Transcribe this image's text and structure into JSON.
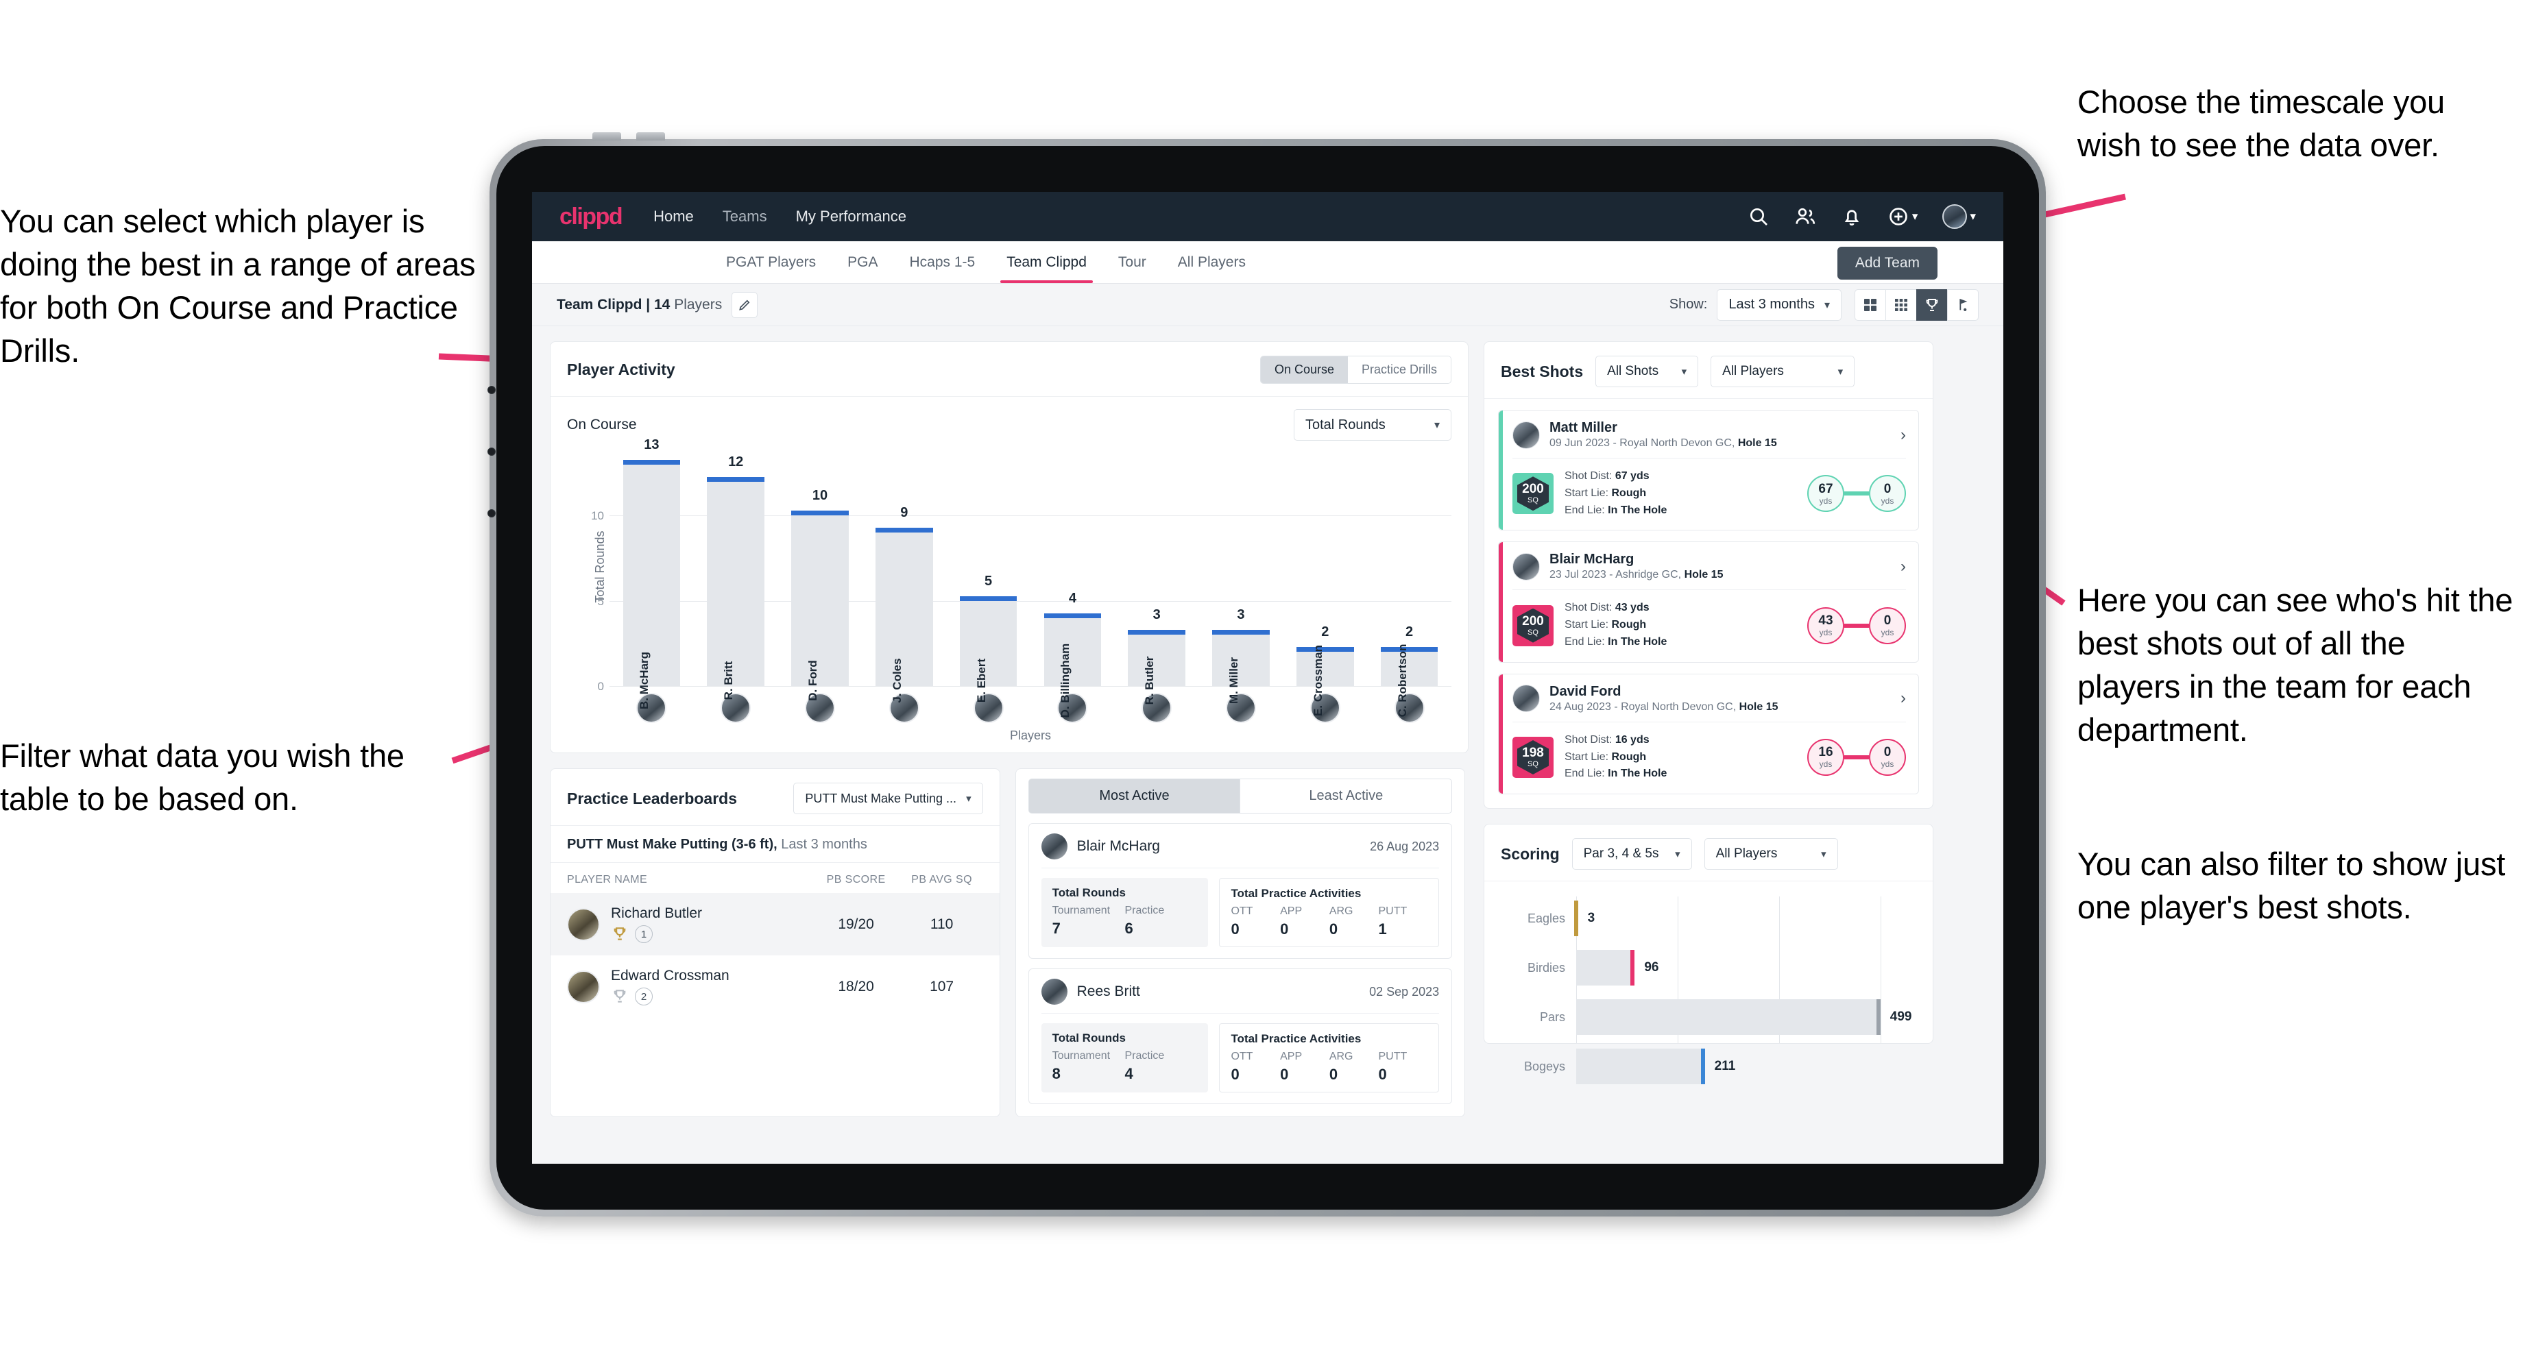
{
  "annotations": {
    "top_right": "Choose the timescale you wish to see the data over.",
    "left_top": "You can select which player is doing the best in a range of areas for both On Course and Practice Drills.",
    "left_bottom": "Filter what data you wish the table to be based on.",
    "right_middle": "Here you can see who's hit the best shots out of all the players in the team for each department.",
    "right_bottom": "You can also filter to show just one player's best shots."
  },
  "topnav": {
    "logo": "clippd",
    "links": [
      "Home",
      "Teams",
      "My Performance"
    ],
    "icons": [
      "search-icon",
      "people-icon",
      "bell-icon",
      "plus-circle-icon",
      "avatar"
    ]
  },
  "tabs": {
    "items": [
      "PGAT Players",
      "PGA",
      "Hcaps 1-5",
      "Team Clippd",
      "Tour",
      "All Players"
    ],
    "active": "Team Clippd",
    "add_team_label": "Add Team"
  },
  "teamstrip": {
    "team_label": "Team Clippd | ",
    "player_count": "14",
    "players_word": " Players",
    "show_label": "Show:",
    "timescale_value": "Last 3 months",
    "view_icons": [
      "grid-4-icon",
      "grid-9-icon",
      "trophy-icon",
      "golf-flag-icon"
    ],
    "active_view": "trophy-icon"
  },
  "player_activity": {
    "title": "Player Activity",
    "segments": [
      "On Course",
      "Practice Drills"
    ],
    "active_segment": "On Course",
    "subtitle": "On Course",
    "metric_select": "Total Rounds"
  },
  "best_shots": {
    "title": "Best Shots",
    "filter_shots": "All Shots",
    "filter_players": "All Players",
    "cards": [
      {
        "accent": "teal",
        "name": "Matt Miller",
        "meta_date": "09 Jun 2023 - Royal North Devon GC, ",
        "meta_hole": "Hole 15",
        "sq_value": "200",
        "sq_unit": "SQ",
        "shot_dist_label": "Shot Dist: ",
        "shot_dist": "67 yds",
        "start_lie_label": "Start Lie: ",
        "start_lie": "Rough",
        "end_lie_label": "End Lie: ",
        "end_lie": "In The Hole",
        "from_value": "67",
        "from_unit": "yds",
        "to_value": "0",
        "to_unit": "yds"
      },
      {
        "accent": "pink",
        "name": "Blair McHarg",
        "meta_date": "23 Jul 2023 - Ashridge GC, ",
        "meta_hole": "Hole 15",
        "sq_value": "200",
        "sq_unit": "SQ",
        "shot_dist_label": "Shot Dist: ",
        "shot_dist": "43 yds",
        "start_lie_label": "Start Lie: ",
        "start_lie": "Rough",
        "end_lie_label": "End Lie: ",
        "end_lie": "In The Hole",
        "from_value": "43",
        "from_unit": "yds",
        "to_value": "0",
        "to_unit": "yds"
      },
      {
        "accent": "pink",
        "name": "David Ford",
        "meta_date": "24 Aug 2023 - Royal North Devon GC, ",
        "meta_hole": "Hole 15",
        "sq_value": "198",
        "sq_unit": "SQ",
        "shot_dist_label": "Shot Dist: ",
        "shot_dist": "16 yds",
        "start_lie_label": "Start Lie: ",
        "start_lie": "Rough",
        "end_lie_label": "End Lie: ",
        "end_lie": "In The Hole",
        "from_value": "16",
        "from_unit": "yds",
        "to_value": "0",
        "to_unit": "yds"
      }
    ]
  },
  "practice_leaderboards": {
    "title": "Practice Leaderboards",
    "drill_select": "PUTT Must Make Putting ...",
    "subtitle_bold": "PUTT Must Make Putting (3-6 ft),",
    "subtitle_soft": " Last 3 months",
    "columns": [
      "PLAYER NAME",
      "PB SCORE",
      "PB AVG SQ"
    ],
    "rows": [
      {
        "name": "Richard Butler",
        "rank": "1",
        "trophy": "gold",
        "pb_score": "19/20",
        "pb_avg_sq": "110"
      },
      {
        "name": "Edward Crossman",
        "rank": "2",
        "trophy": "silver",
        "pb_score": "18/20",
        "pb_avg_sq": "107"
      }
    ]
  },
  "activity_panel": {
    "tabs": [
      "Most Active",
      "Least Active"
    ],
    "active_tab": "Most Active",
    "rounds_title": "Total Rounds",
    "rounds_keys": [
      "Tournament",
      "Practice"
    ],
    "acts_title": "Total Practice Activities",
    "acts_keys": [
      "OTT",
      "APP",
      "ARG",
      "PUTT"
    ],
    "cards": [
      {
        "name": "Blair McHarg",
        "date": "26 Aug 2023",
        "rounds": [
          "7",
          "6"
        ],
        "acts": [
          "0",
          "0",
          "0",
          "1"
        ]
      },
      {
        "name": "Rees Britt",
        "date": "02 Sep 2023",
        "rounds": [
          "8",
          "4"
        ],
        "acts": [
          "0",
          "0",
          "0",
          "0"
        ]
      }
    ]
  },
  "scoring": {
    "title": "Scoring",
    "par_select": "Par 3, 4 & 5s",
    "player_select": "All Players"
  },
  "chart_data": [
    {
      "type": "bar",
      "title": "Player Activity - On Course",
      "xlabel": "Players",
      "ylabel": "Total Rounds",
      "ylim": [
        0,
        14
      ],
      "yticks": [
        0,
        5,
        10
      ],
      "grid": true,
      "categories": [
        "B. McHarg",
        "R. Britt",
        "D. Ford",
        "J. Coles",
        "E. Ebert",
        "D. Billingham",
        "R. Butler",
        "M. Miller",
        "E. Crossman",
        "C. Robertson"
      ],
      "values": [
        13,
        12,
        10,
        9,
        5,
        4,
        3,
        3,
        2,
        2
      ],
      "bar_color": "#e4e7eb",
      "cap_color": "#2f6fd0"
    },
    {
      "type": "bar",
      "orientation": "horizontal",
      "title": "Scoring",
      "categories": [
        "Eagles",
        "Birdies",
        "Pars",
        "Bogeys"
      ],
      "values": [
        3,
        96,
        499,
        211
      ],
      "xlim": [
        0,
        560
      ],
      "grid": true,
      "cap_colors": [
        "#c09a3e",
        "#e8336e",
        "#9aa1a9",
        "#3a86d6"
      ],
      "bar_color": "#e4e7eb"
    }
  ]
}
